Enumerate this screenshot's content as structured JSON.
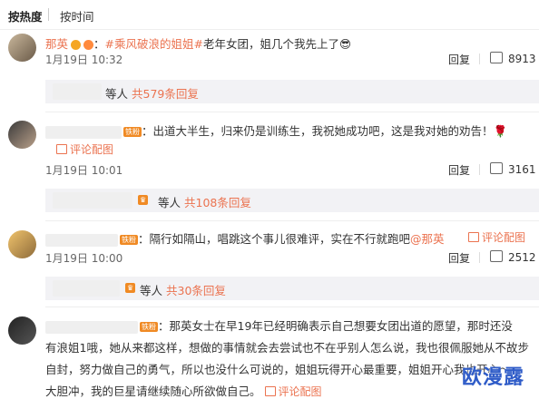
{
  "tabs": {
    "hot": "按热度",
    "time": "按时间"
  },
  "comments": [
    {
      "user": "那英",
      "text_pre": "：",
      "topic": "#乘风破浪的姐姐#",
      "text_post": "老年女团，姐几个我先上了",
      "emoji": "😎",
      "date": "1月19日 10:32",
      "reply": "回复",
      "likes": "8913",
      "replies_prefix": "等人",
      "replies_count": "共579条回复"
    },
    {
      "badge": "铁粉",
      "text": "：出道大半生，归来仍是训练生，我祝她成功吧，这是我对她的劝告！",
      "emoji": "🌹",
      "pic": "评论配图",
      "date": "1月19日 10:01",
      "reply": "回复",
      "likes": "3161",
      "replies_prefix": "等人",
      "replies_count": "共108条回复"
    },
    {
      "badge": "铁粉",
      "text_pre": "：隔行如隔山，唱跳这个事儿很难评，实在不行就跑吧",
      "mention": "@那英",
      "pic": "评论配图",
      "date": "1月19日 10:00",
      "reply": "回复",
      "likes": "2512",
      "replies_prefix": "等人",
      "replies_count": "共30条回复"
    },
    {
      "badge": "铁粉",
      "line1": "：那英女士在早19年已经明确表示自己想要女团出道的愿望，那时还没",
      "line2": "有浪姐1哦，她从来都这样，想做的事情就会去尝试也不在乎别人怎么说，我也很佩服她从不故步",
      "line3": "自封，努力做自己的勇气，所以也没什么可说的，姐姐玩得开心最重要，姐姐开心我也开心～",
      "line4": "大胆冲，我的巨星请继续随心所欲做自己。",
      "pic": "评论配图"
    }
  ],
  "watermark": "欧漫露",
  "colors": {
    "accent": "#eb7350",
    "link_blue": "#2f5cc8"
  }
}
